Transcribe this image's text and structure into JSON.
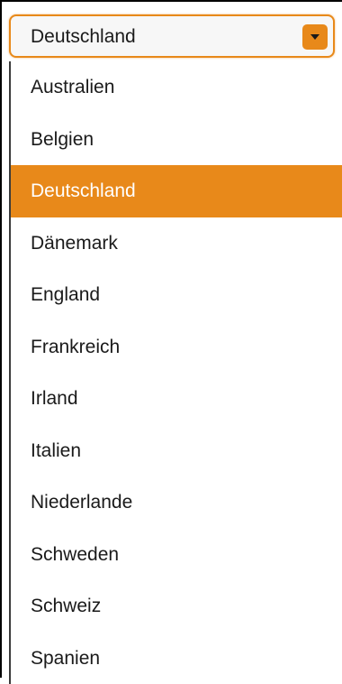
{
  "select": {
    "value": "Deutschland",
    "accent_color": "#e8891a",
    "arrow_icon": "caret-down-icon"
  },
  "dropdown": {
    "options": [
      {
        "label": "Australien",
        "selected": false
      },
      {
        "label": "Belgien",
        "selected": false
      },
      {
        "label": "Deutschland",
        "selected": true
      },
      {
        "label": "Dänemark",
        "selected": false
      },
      {
        "label": "England",
        "selected": false
      },
      {
        "label": "Frankreich",
        "selected": false
      },
      {
        "label": "Irland",
        "selected": false
      },
      {
        "label": "Italien",
        "selected": false
      },
      {
        "label": "Niederlande",
        "selected": false
      },
      {
        "label": "Schweden",
        "selected": false
      },
      {
        "label": "Schweiz",
        "selected": false
      },
      {
        "label": "Spanien",
        "selected": false
      }
    ]
  }
}
